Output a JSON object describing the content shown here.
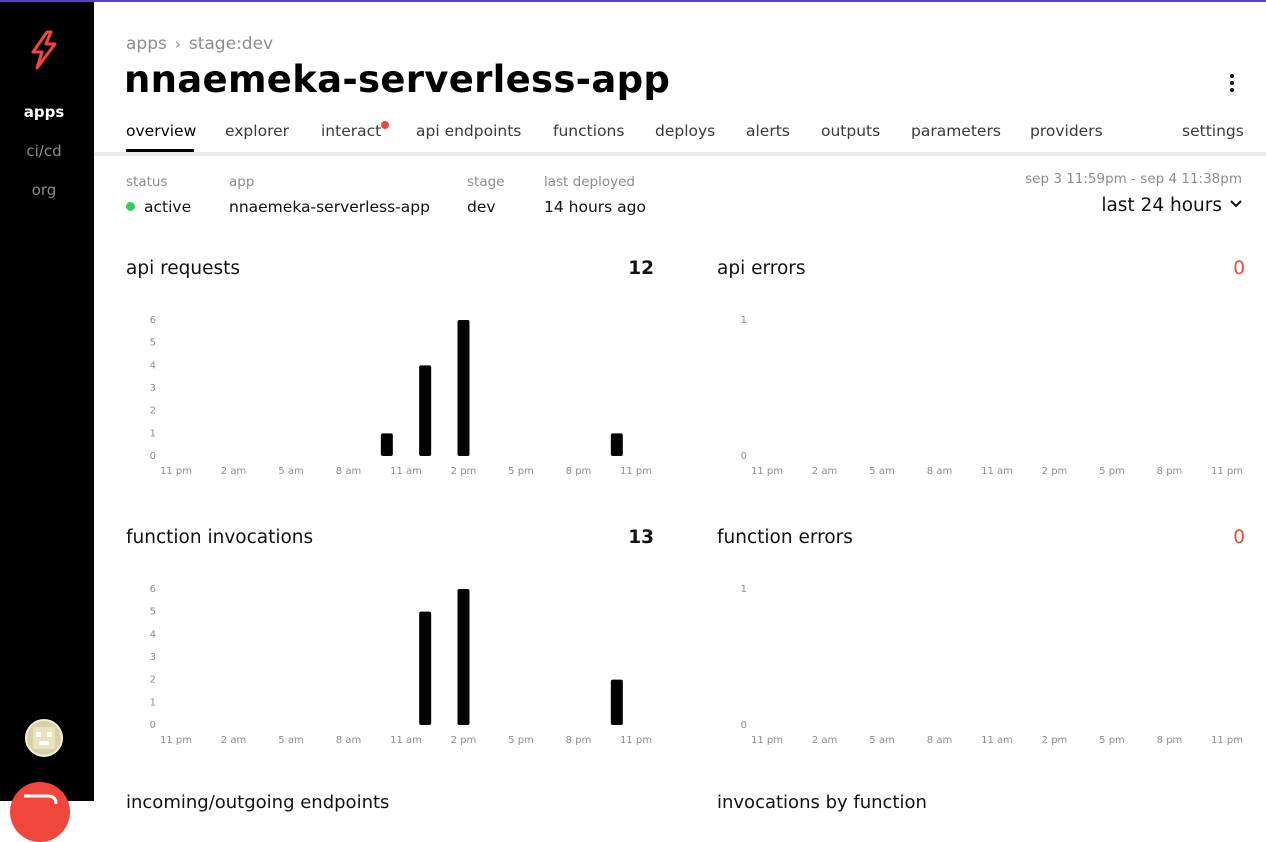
{
  "sidebar": {
    "items": [
      {
        "label": "apps",
        "active": true
      },
      {
        "label": "ci/cd",
        "active": false
      },
      {
        "label": "org",
        "active": false
      }
    ],
    "logo_icon": "lightning-bolt-icon",
    "accent": "#f0463b"
  },
  "breadcrumb": {
    "root": "apps",
    "current": "stage:dev"
  },
  "page_title": "nnaemeka-serverless-app",
  "tabs": [
    {
      "label": "overview",
      "active": true
    },
    {
      "label": "explorer"
    },
    {
      "label": "interact",
      "badge": true
    },
    {
      "label": "api endpoints"
    },
    {
      "label": "functions"
    },
    {
      "label": "deploys"
    },
    {
      "label": "alerts"
    },
    {
      "label": "outputs"
    },
    {
      "label": "parameters"
    },
    {
      "label": "providers"
    },
    {
      "label": "settings"
    }
  ],
  "meta": {
    "status_label": "status",
    "status_value": "active",
    "app_label": "app",
    "app_value": "nnaemeka-serverless-app",
    "stage_label": "stage",
    "stage_value": "dev",
    "deployed_label": "last deployed",
    "deployed_value": "14 hours ago"
  },
  "time_range": {
    "span": "sep 3 11:59pm - sep 4 11:38pm",
    "selected": "last 24 hours"
  },
  "panels": {
    "api_requests": {
      "title": "api requests",
      "total": "12"
    },
    "api_errors": {
      "title": "api errors",
      "total": "0"
    },
    "function_invocations": {
      "title": "function invocations",
      "total": "13"
    },
    "function_errors": {
      "title": "function errors",
      "total": "0"
    }
  },
  "chart_data": [
    {
      "type": "bar",
      "title": "api requests",
      "categories": [
        "11 pm",
        "2 am",
        "5 am",
        "8 am",
        "11 am",
        "2 pm",
        "5 pm",
        "8 pm",
        "11 pm"
      ],
      "bars": [
        {
          "x": 11,
          "y": 1
        },
        {
          "x": 13,
          "y": 4
        },
        {
          "x": 15,
          "y": 6
        },
        {
          "x": 23,
          "y": 1
        }
      ],
      "y_ticks": [
        0,
        1,
        2,
        3,
        4,
        5,
        6
      ],
      "ylim": [
        0,
        6
      ]
    },
    {
      "type": "bar",
      "title": "api errors",
      "categories": [
        "11 pm",
        "2 am",
        "5 am",
        "8 am",
        "11 am",
        "2 pm",
        "5 pm",
        "8 pm",
        "11 pm"
      ],
      "bars": [],
      "y_ticks": [
        0,
        1
      ],
      "ylim": [
        0,
        1
      ]
    },
    {
      "type": "bar",
      "title": "function invocations",
      "categories": [
        "11 pm",
        "2 am",
        "5 am",
        "8 am",
        "11 am",
        "2 pm",
        "5 pm",
        "8 pm",
        "11 pm"
      ],
      "bars": [
        {
          "x": 13,
          "y": 5
        },
        {
          "x": 15,
          "y": 6
        },
        {
          "x": 23,
          "y": 2
        }
      ],
      "y_ticks": [
        0,
        1,
        2,
        3,
        4,
        5,
        6
      ],
      "ylim": [
        0,
        6
      ]
    },
    {
      "type": "bar",
      "title": "function errors",
      "categories": [
        "11 pm",
        "2 am",
        "5 am",
        "8 am",
        "11 am",
        "2 pm",
        "5 pm",
        "8 pm",
        "11 pm"
      ],
      "bars": [],
      "y_ticks": [
        0,
        1
      ],
      "ylim": [
        0,
        1
      ]
    }
  ],
  "lower_panels": {
    "left_title": "incoming/outgoing endpoints",
    "right_title": "invocations by function"
  }
}
